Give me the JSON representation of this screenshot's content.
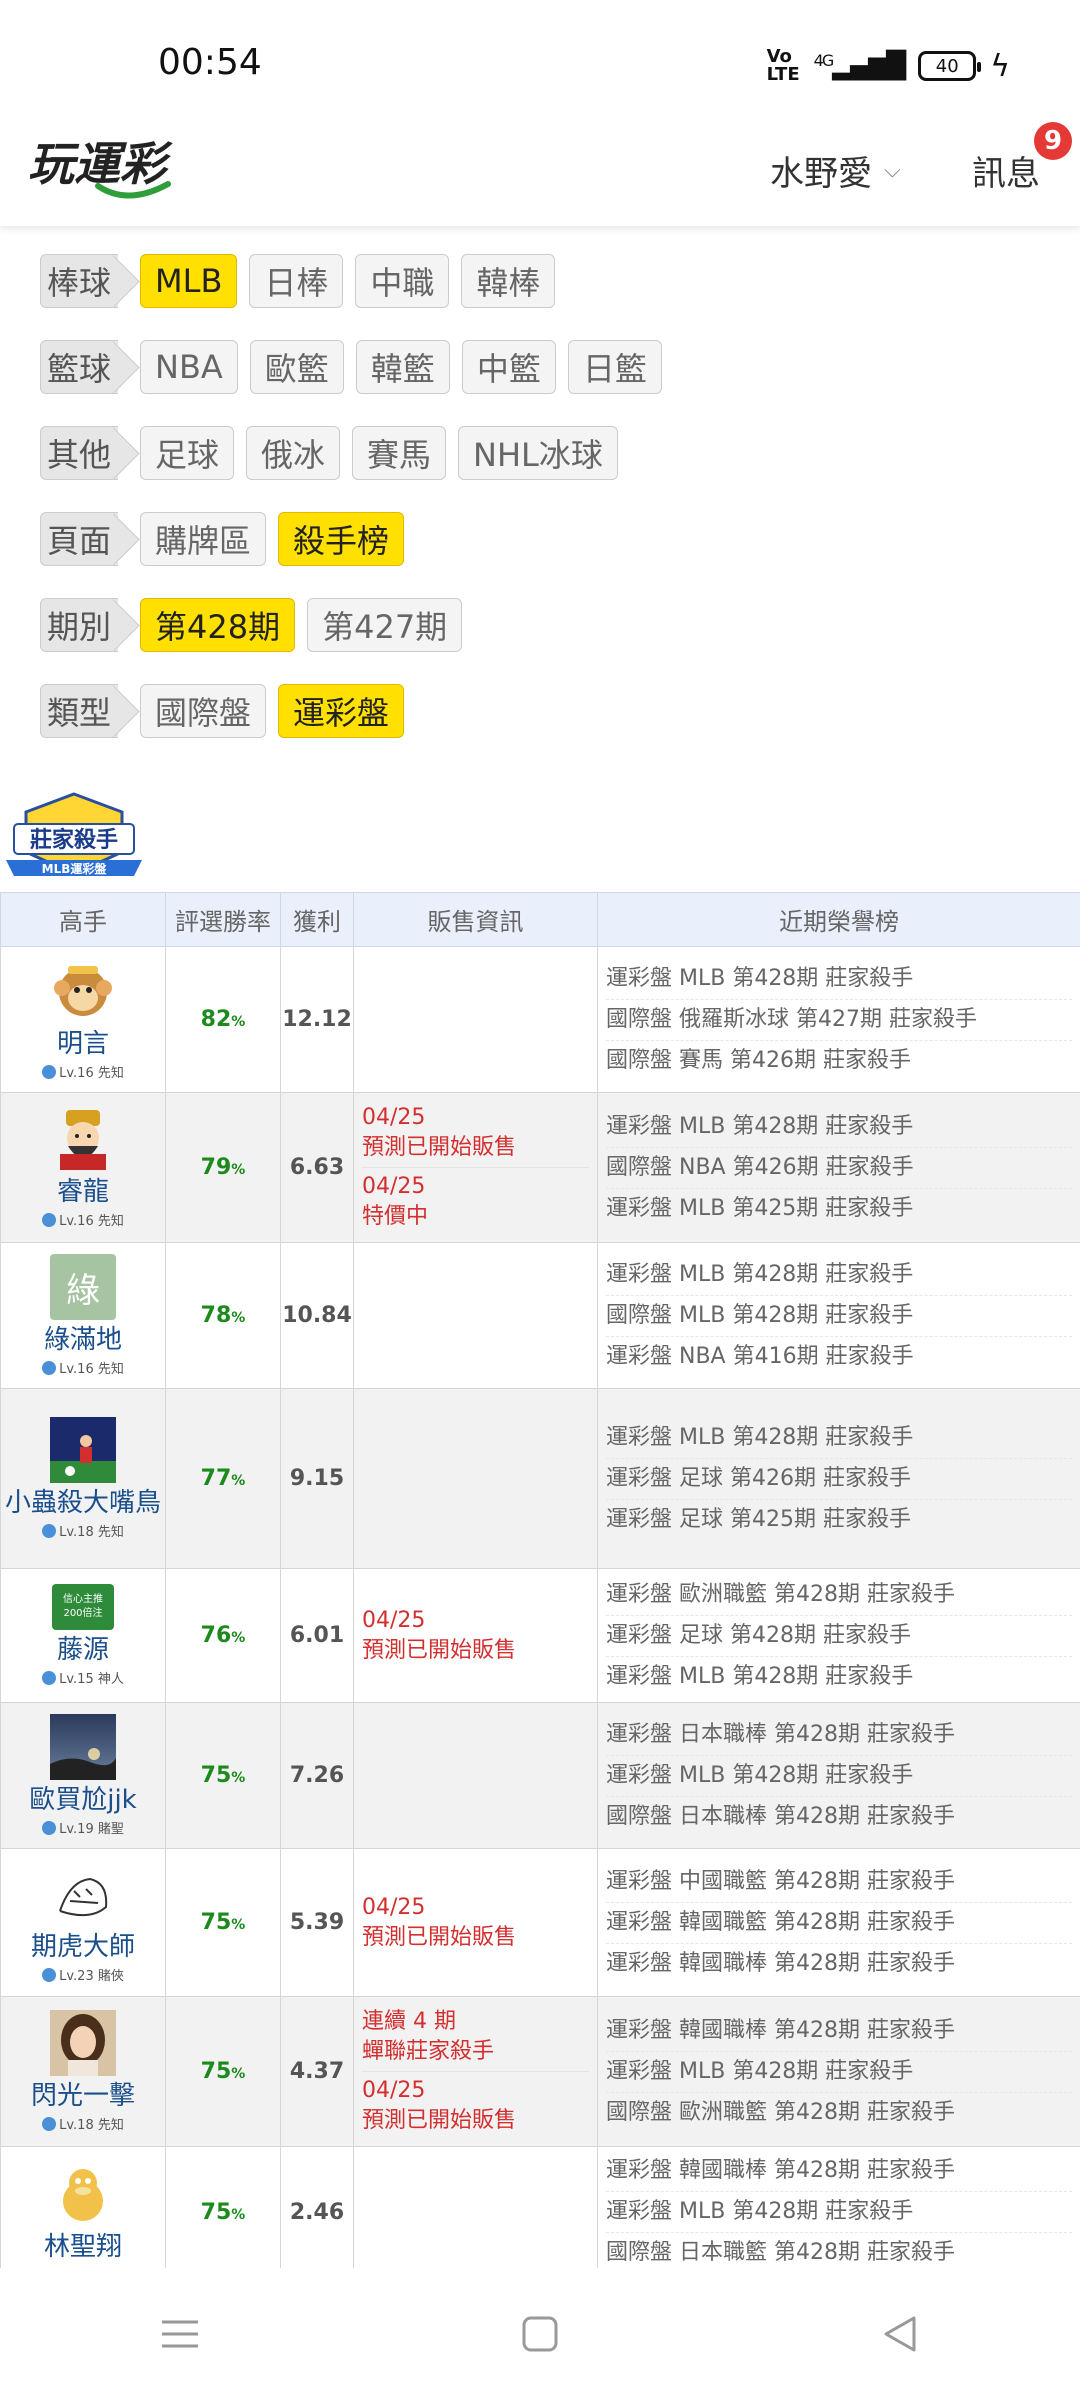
{
  "status_bar": {
    "time": "00:54",
    "network": "4G",
    "battery": "40"
  },
  "header": {
    "user_name": "水野愛",
    "messages_label": "訊息",
    "messages_count": "9"
  },
  "filters": [
    {
      "label": "棒球",
      "options": [
        {
          "text": "MLB",
          "active": true
        },
        {
          "text": "日棒"
        },
        {
          "text": "中職"
        },
        {
          "text": "韓棒"
        }
      ]
    },
    {
      "label": "籃球",
      "options": [
        {
          "text": "NBA"
        },
        {
          "text": "歐籃"
        },
        {
          "text": "韓籃"
        },
        {
          "text": "中籃"
        },
        {
          "text": "日籃"
        }
      ]
    },
    {
      "label": "其他",
      "options": [
        {
          "text": "足球"
        },
        {
          "text": "俄冰"
        },
        {
          "text": "賽馬"
        },
        {
          "text": "NHL冰球"
        }
      ]
    },
    {
      "label": "頁面",
      "options": [
        {
          "text": "購牌區"
        },
        {
          "text": "殺手榜",
          "active": true
        }
      ]
    },
    {
      "label": "期別",
      "options": [
        {
          "text": "第428期",
          "active": true
        },
        {
          "text": "第427期"
        }
      ]
    },
    {
      "label": "類型",
      "options": [
        {
          "text": "國際盤"
        },
        {
          "text": "運彩盤",
          "active": true
        }
      ]
    }
  ],
  "badge": {
    "title": "莊家殺手",
    "subtitle": "MLB運彩盤"
  },
  "table": {
    "headers": [
      "高手",
      "評選勝率",
      "獲利",
      "販售資訊",
      "近期榮譽榜"
    ],
    "rows": [
      {
        "name": "明言",
        "level": "Lv.16 先知",
        "rate": "82",
        "profit": "12.12",
        "sale": [],
        "honors": [
          "運彩盤 MLB 第428期 莊家殺手",
          "國際盤 俄羅斯冰球 第427期 莊家殺手",
          "國際盤 賽馬 第426期 莊家殺手"
        ]
      },
      {
        "name": "睿龍",
        "level": "Lv.16 先知",
        "rate": "79",
        "profit": "6.63",
        "sale": [
          [
            "04/25",
            "預測已開始販售"
          ],
          [
            "04/25",
            "特價中"
          ]
        ],
        "honors": [
          "運彩盤 MLB 第428期 莊家殺手",
          "國際盤 NBA 第426期 莊家殺手",
          "運彩盤 MLB 第425期 莊家殺手"
        ]
      },
      {
        "name": "綠滿地",
        "level": "Lv.16 先知",
        "rate": "78",
        "profit": "10.84",
        "sale": [],
        "honors": [
          "運彩盤 MLB 第428期 莊家殺手",
          "國際盤 MLB 第428期 莊家殺手",
          "運彩盤 NBA 第416期 莊家殺手"
        ]
      },
      {
        "name": "小蟲殺大嘴鳥",
        "level": "Lv.18 先知",
        "rate": "77",
        "profit": "9.15",
        "sale": [],
        "honors": [
          "運彩盤 MLB 第428期 莊家殺手",
          "運彩盤 足球 第426期 莊家殺手",
          "運彩盤 足球 第425期 莊家殺手"
        ]
      },
      {
        "name": "藤源",
        "level": "Lv.15 神人",
        "rate": "76",
        "profit": "6.01",
        "sale": [
          [
            "04/25",
            "預測已開始販售"
          ]
        ],
        "honors": [
          "運彩盤 歐洲職籃 第428期 莊家殺手",
          "運彩盤 足球 第428期 莊家殺手",
          "運彩盤 MLB 第428期 莊家殺手"
        ]
      },
      {
        "name": "歐買尬jjk",
        "level": "Lv.19 賭聖",
        "rate": "75",
        "profit": "7.26",
        "sale": [],
        "honors": [
          "運彩盤 日本職棒 第428期 莊家殺手",
          "運彩盤 MLB 第428期 莊家殺手",
          "國際盤 日本職棒 第428期 莊家殺手"
        ]
      },
      {
        "name": "期虎大師",
        "level": "Lv.23 賭俠",
        "rate": "75",
        "profit": "5.39",
        "sale": [
          [
            "04/25",
            "預測已開始販售"
          ]
        ],
        "honors": [
          "運彩盤 中國職籃 第428期 莊家殺手",
          "運彩盤 韓國職籃 第428期 莊家殺手",
          "運彩盤 韓國職棒 第428期 莊家殺手"
        ]
      },
      {
        "name": "閃光一擊",
        "level": "Lv.18 先知",
        "rate": "75",
        "profit": "4.37",
        "sale": [
          [
            "連續 4 期",
            "蟬聯莊家殺手"
          ],
          [
            "04/25",
            "預測已開始販售"
          ]
        ],
        "honors": [
          "運彩盤 韓國職棒 第428期 莊家殺手",
          "運彩盤 MLB 第428期 莊家殺手",
          "國際盤 歐洲職籃 第428期 莊家殺手"
        ]
      },
      {
        "name": "林聖翔",
        "level": "",
        "rate": "75",
        "profit": "2.46",
        "sale": [],
        "honors": [
          "運彩盤 韓國職棒 第428期 莊家殺手",
          "運彩盤 MLB 第428期 莊家殺手",
          "國際盤 日本職籃 第428期 莊家殺手"
        ]
      }
    ]
  },
  "avatars": [
    "monkey-avatar",
    "god-of-wealth-avatar",
    "green-letter-avatar",
    "soccer-player-avatar",
    "green-sign-avatar",
    "night-sky-avatar",
    "tiger-sketch-avatar",
    "woman-photo-avatar",
    "duck-avatar"
  ],
  "avatar_text": {
    "green_letter": "綠",
    "green_sign": "信心主推 200倍注"
  },
  "unit": "%",
  "colors": {
    "active_chip": "#ffe000",
    "rate_green": "#1c8a1c",
    "sale_red": "#d32f2f",
    "name_blue": "#1a4f8c",
    "badge_red": "#e53935"
  }
}
